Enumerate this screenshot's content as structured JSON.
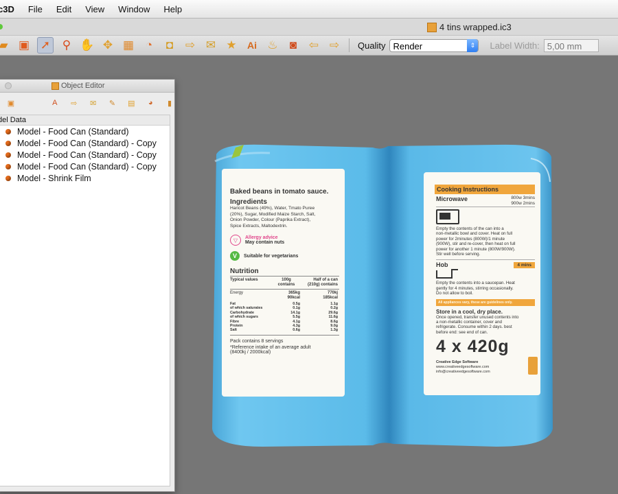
{
  "menubar": {
    "app": "c3D",
    "items": [
      "File",
      "Edit",
      "View",
      "Window",
      "Help"
    ]
  },
  "window": {
    "title": "4 tins wrapped.ic3"
  },
  "toolbar": {
    "icons": [
      "open-folder-icon",
      "save-icon",
      "pointer-icon",
      "zoom-icon",
      "pan-hand-icon",
      "move-icon",
      "frame-icon",
      "rotate-icon",
      "fit-view-icon",
      "export-icon",
      "image-icon",
      "star-icon",
      "ai-icon",
      "photoshop-icon",
      "camera-icon",
      "undo-icon",
      "redo-icon"
    ],
    "quality_label": "Quality",
    "quality_value": "Render",
    "label_width_label": "Label Width:",
    "label_width_value": "5,00 mm"
  },
  "object_editor": {
    "title": "Object Editor",
    "header": "del Data",
    "items": [
      "Model - Food Can (Standard)",
      "Model - Food Can (Standard) - Copy",
      "Model - Food Can (Standard) - Copy",
      "Model - Food Can (Standard) - Copy",
      "Model - Shrink Film"
    ]
  },
  "label_left": {
    "product": "Baked beans in tomato sauce.",
    "ingredients_title": "Ingredients",
    "ingredients_lines": [
      "Haricot Beans (49%), Water, Tmato Puree",
      "(20%), Sugar, Modified Maize Starch, Salt,",
      "Onion Powder, Colour (Paprika Extract),",
      "Spice Extracts, Maltodextrin."
    ],
    "allergy_title": "Allergy advice",
    "allergy_text": "May contain nuts",
    "veg_text": "Suitable for vegetarians",
    "nutrition_title": "Nutrition",
    "col1": "Typical values",
    "col2a": "100g",
    "col2b": "contains",
    "col3a": "Half of a can",
    "col3b": "(210g) contains",
    "energy_label": "Energy",
    "energy_100": [
      "365kg",
      "90kcal"
    ],
    "energy_half": [
      "770kj",
      "185kcal"
    ],
    "rows": [
      {
        "label": "Fat",
        "v100": "0.5g",
        "half": "1.1g"
      },
      {
        "label": "of which saturates",
        "v100": "0.1g",
        "half": "0.2g"
      },
      {
        "label": "Carbohydrate",
        "v100": "14.1g",
        "half": "29.6g"
      },
      {
        "label": "of which sugars",
        "v100": "5.5g",
        "half": "11.6g"
      },
      {
        "label": "Fibre",
        "v100": "4.1g",
        "half": "8.6g"
      },
      {
        "label": "Protein",
        "v100": "4.3g",
        "half": "9.0g"
      },
      {
        "label": "Salt",
        "v100": "0.6g",
        "half": "1.3g"
      }
    ],
    "pack_text": "Pack contains 8 servings",
    "reference_text": "*Reference intake of an average adult",
    "reference_text2": "(8400kj / 2000kcal)"
  },
  "label_right": {
    "cooking_title": "Cooking Instructions",
    "microwave_title": "Microwave",
    "mw_times": [
      "800w  3mins",
      "900w  2mins"
    ],
    "mw_lines": [
      "Empty the contents of the can into a",
      "non-metallic bowl and cover. Heat on full",
      "power for 2minutes (800W)/1 minute",
      "(900W), stir and re-cover, then heat on full",
      "power for another 1 minute (800W/900W).",
      "Stir well before serving."
    ],
    "hob_title": "Hob",
    "hob_time": "4 mins",
    "hob_lines": [
      "Empty the contents into a saucepan. Heat",
      "gently for 4 minutes, stirring occasionally.",
      "Do not allow to boil."
    ],
    "guideline": "All appliances vary, these are guidelines only.",
    "store_title": "Store in a  cool, dry place.",
    "store_lines": [
      "Once opened, transfer unused contents into",
      "a non-metallic container, cover and",
      "refrigerate. Consume within 2 days. best",
      "before end: see end of can."
    ],
    "weight": "4 x 420g",
    "company": "Creative Edge Software",
    "website": "www.creativeedgesoftware.com",
    "email": "info@creativeedgesoftware.com"
  },
  "colors": {
    "can_blue": "#4db3e6",
    "accent_orange": "#f0a63c",
    "allergy_pink": "#e0458a",
    "veg_green": "#55b945"
  }
}
